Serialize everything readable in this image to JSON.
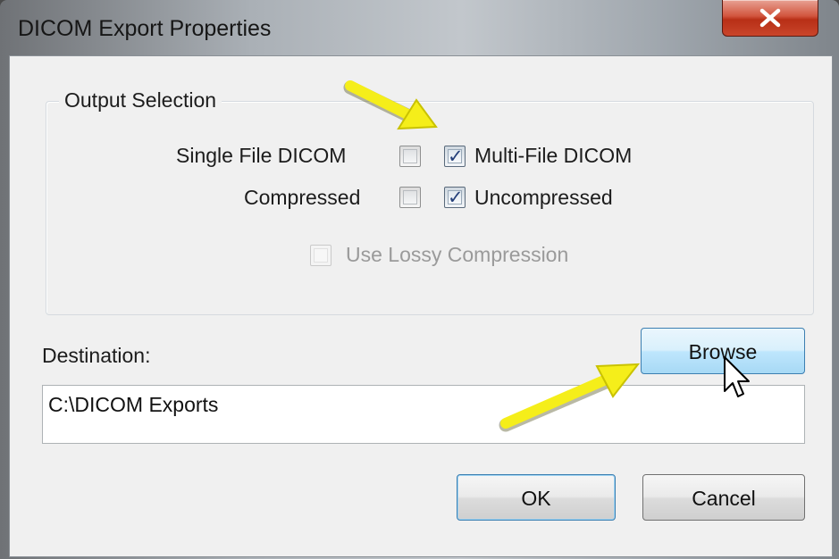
{
  "window": {
    "title": "DICOM Export Properties",
    "close_symbol": "✕"
  },
  "output_selection": {
    "legend": "Output Selection",
    "single_file_label": "Single File DICOM",
    "single_file_checked": false,
    "multi_file_label": "Multi-File DICOM",
    "multi_file_checked": true,
    "compressed_label": "Compressed",
    "compressed_checked": false,
    "uncompressed_label": "Uncompressed",
    "uncompressed_checked": true,
    "lossy_label": "Use Lossy Compression",
    "lossy_checked": false,
    "lossy_enabled": false
  },
  "destination": {
    "label": "Destination:",
    "value": "C:\\DICOM Exports",
    "browse_label": "Browse"
  },
  "buttons": {
    "ok_label": "OK",
    "cancel_label": "Cancel"
  },
  "annotations": {
    "arrow_color": "#f5ee1a",
    "cursor_icon": "mouse-pointer-icon"
  }
}
